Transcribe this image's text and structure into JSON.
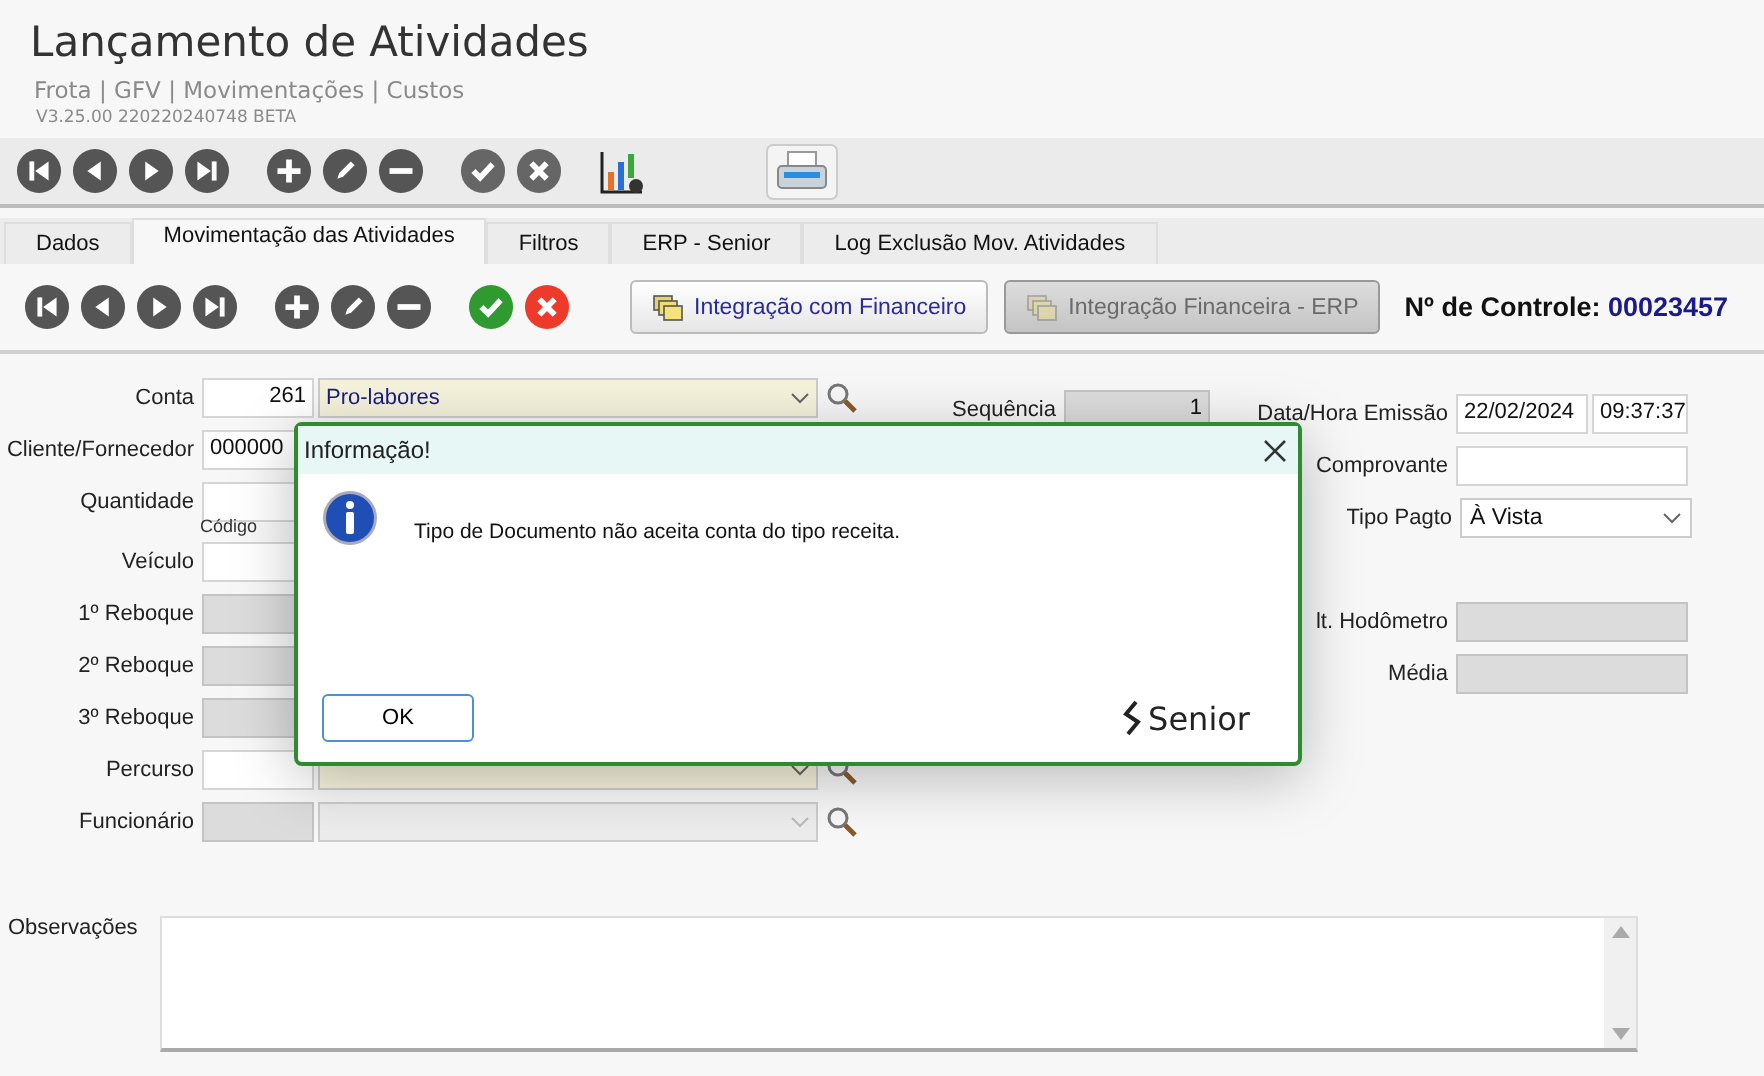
{
  "header": {
    "title": "Lançamento de Atividades",
    "breadcrumb": "Frota | GFV | Movimentações | Custos",
    "version": "V3.25.00 220220240748 BETA"
  },
  "toolbar": [
    {
      "kind": "first",
      "enabled": true
    },
    {
      "kind": "prev",
      "enabled": true
    },
    {
      "kind": "next",
      "enabled": true
    },
    {
      "kind": "last",
      "enabled": true
    },
    {
      "kind": "add",
      "enabled": true
    },
    {
      "kind": "edit",
      "enabled": true
    },
    {
      "kind": "remove",
      "enabled": true
    },
    {
      "kind": "confirm",
      "enabled": false
    },
    {
      "kind": "cancel",
      "enabled": false
    },
    {
      "kind": "chart",
      "enabled": true
    },
    {
      "kind": "print",
      "enabled": true
    }
  ],
  "tabs": [
    {
      "label": "Dados",
      "selected": false
    },
    {
      "label": "Movimentação das Atividades",
      "selected": true
    },
    {
      "label": "Filtros",
      "selected": false
    },
    {
      "label": "ERP - Senior",
      "selected": false
    },
    {
      "label": "Log Exclusão Mov. Atividades",
      "selected": false
    }
  ],
  "panel_toolbar": [
    {
      "kind": "first",
      "enabled": true
    },
    {
      "kind": "prev",
      "enabled": true
    },
    {
      "kind": "next",
      "enabled": true
    },
    {
      "kind": "last",
      "enabled": true
    },
    {
      "kind": "add",
      "enabled": true
    },
    {
      "kind": "edit",
      "enabled": true
    },
    {
      "kind": "remove",
      "enabled": true
    },
    {
      "kind": "confirm",
      "enabled": true
    },
    {
      "kind": "cancel",
      "enabled": true
    }
  ],
  "actions": [
    {
      "label": "Integração com Financeiro",
      "disabled": false
    },
    {
      "label": "Integração Financeira - ERP",
      "disabled": true
    }
  ],
  "control": {
    "label": "Nº de Controle:",
    "value": "00023457"
  },
  "left_fields": [
    {
      "label": "Conta",
      "kind": "lookup",
      "code": "261",
      "value": "Pro-labores",
      "disabled": false
    },
    {
      "label": "Cliente/Fornecedor",
      "kind": "code",
      "code": "000000",
      "disabled": false
    },
    {
      "label": "Quantidade",
      "kind": "code",
      "disabled": false
    },
    {
      "label": "Código",
      "kind": "caption"
    },
    {
      "label": "Veículo",
      "kind": "code",
      "disabled": false
    },
    {
      "label": "1º Reboque",
      "kind": "code",
      "disabled": true
    },
    {
      "label": "2º Reboque",
      "kind": "code",
      "disabled": true
    },
    {
      "label": "3º Reboque",
      "kind": "code",
      "disabled": true
    },
    {
      "label": "Percurso",
      "kind": "lookup",
      "disabled": false
    },
    {
      "label": "Funcionário",
      "kind": "lookup",
      "disabled": true
    }
  ],
  "sequence": {
    "label": "Sequência",
    "value": "1"
  },
  "right_fields": [
    {
      "label": "Data/Hora Emissão",
      "kind": "pair",
      "value": "22/02/2024",
      "value2": "09:37:37",
      "disabled": false
    },
    {
      "label": "Comprovante",
      "kind": "text",
      "disabled": false
    },
    {
      "label": "Tipo Pagto",
      "kind": "select",
      "value": "À Vista",
      "disabled": false
    },
    {
      "kind": "spacer"
    },
    {
      "label": "lt. Hodômetro",
      "kind": "text",
      "disabled": true
    },
    {
      "label": "Média",
      "kind": "text",
      "disabled": true
    }
  ],
  "notes": {
    "label": "Observações"
  },
  "dialog": {
    "title": "Informação!",
    "message": "Tipo de Documento não aceita conta do tipo receita.",
    "button": "OK",
    "brand": "Senior"
  }
}
